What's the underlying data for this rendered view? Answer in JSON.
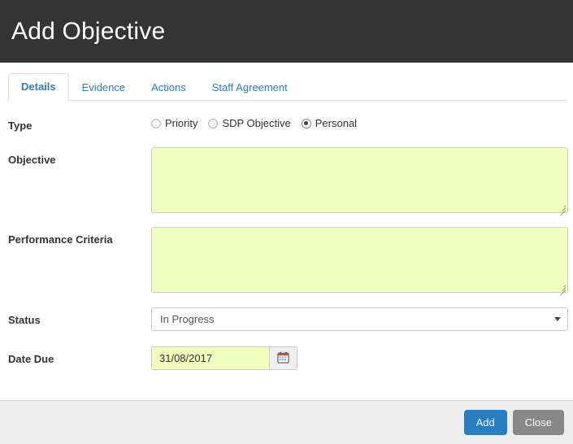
{
  "header": {
    "title": "Add Objective"
  },
  "tabs": [
    {
      "label": "Details",
      "active": true
    },
    {
      "label": "Evidence",
      "active": false
    },
    {
      "label": "Actions",
      "active": false
    },
    {
      "label": "Staff Agreement",
      "active": false
    }
  ],
  "form": {
    "type": {
      "label": "Type",
      "options": [
        {
          "label": "Priority",
          "selected": false
        },
        {
          "label": "SDP Objective",
          "selected": false
        },
        {
          "label": "Personal",
          "selected": true
        }
      ]
    },
    "objective": {
      "label": "Objective",
      "value": "",
      "placeholder": ""
    },
    "performance_criteria": {
      "label": "Performance Criteria",
      "value": "",
      "placeholder": ""
    },
    "status": {
      "label": "Status",
      "value": "In Progress",
      "options": [
        "In Progress"
      ]
    },
    "date_due": {
      "label": "Date Due",
      "value": "31/08/2017",
      "placeholder": "",
      "picker_icon": "calendar-icon"
    }
  },
  "footer": {
    "add_label": "Add",
    "close_label": "Close"
  },
  "colors": {
    "header_bg": "#343434",
    "accent": "#337ab7",
    "primary_button": "#2b7dc2",
    "default_button": "#888888",
    "highlight_field": "#f3ffbf",
    "footer_bg": "#ededed"
  }
}
